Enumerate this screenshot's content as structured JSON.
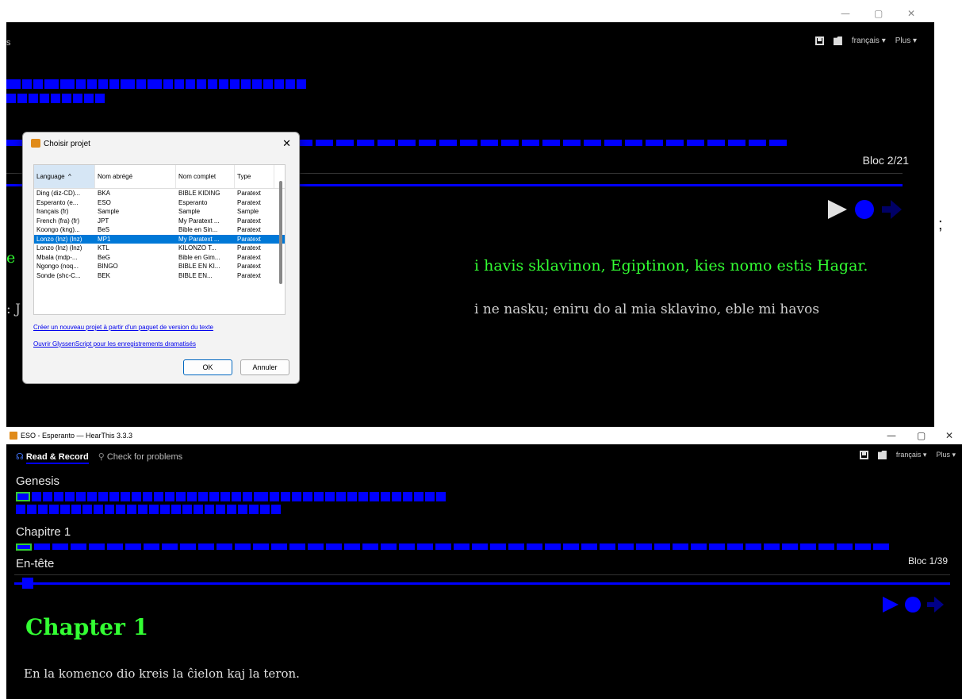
{
  "back_window": {
    "window_controls": [
      "—",
      "▢",
      "✕"
    ],
    "top_left_fragment": "s",
    "toolbar": {
      "language": "français",
      "more": "Plus"
    },
    "bloc": "Bloc 2/21",
    "semicolon": ";",
    "green_left": "e",
    "green_text": "i havis sklavinon, Egiptinon, kies nomo estis Hagar.",
    "grey_left": ": J",
    "grey_text": "i ne nasku; eniru do al mia sklavino, eble mi havos"
  },
  "dialog": {
    "title": "Choisir projet",
    "close": "✕",
    "columns": [
      "Language",
      "Nom abrégé",
      "Nom complet",
      "Type"
    ],
    "rows": [
      [
        "Ding (diz-CD)...",
        "BKA",
        "BIBLE KIDING",
        "Paratext"
      ],
      [
        "Esperanto (e...",
        "ESO",
        "Esperanto",
        "Paratext"
      ],
      [
        "français (fr)",
        "Sample",
        "Sample",
        "Sample"
      ],
      [
        "French (fra) (fr)",
        "JPT",
        "My Paratext ...",
        "Paratext"
      ],
      [
        "Koongo (kng)...",
        "BeS",
        "Bible en Sin...",
        "Paratext"
      ],
      [
        "Lonzo (lnz) (lnz)",
        "MP1",
        "My Paratext ...",
        "Paratext"
      ],
      [
        "Lonzo (lnz) (lnz)",
        "KTL",
        "KILONZO T...",
        "Paratext"
      ],
      [
        "Mbala (mdp-...",
        "BeG",
        "Bible en Gim...",
        "Paratext"
      ],
      [
        "Ngongo (noq...",
        "BINGO",
        "BIBLE EN KI...",
        "Paratext"
      ],
      [
        "Sonde (shc-C...",
        "BEK",
        "BIBLE EN...",
        "Paratext"
      ]
    ],
    "selected_row_index": 5,
    "link_create": "Créer un nouveau projet à partir d'un paquet de version du texte",
    "link_glyssen": "Ouvrir GlyssenScript pour les enregistrements dramatisés",
    "ok": "OK",
    "cancel": "Annuler"
  },
  "front_window": {
    "title": "ESO - Esperanto — HearThis 3.3.3",
    "window_controls": [
      "—",
      "▢",
      "✕"
    ],
    "tab_read": "Read & Record",
    "tab_check": "Check for problems",
    "toolbar": {
      "language": "français",
      "more": "Plus"
    },
    "book": "Genesis",
    "chapter": "Chapitre 1",
    "block": "En-tête",
    "bloc": "Bloc 1/39",
    "chapter_heading": "Chapter 1",
    "verse": "En la komenco dio kreis la ĉielon kaj la teron."
  },
  "colors": {
    "accent_blue": "#0000ff",
    "green_text": "#33ff33",
    "background": "#000000"
  }
}
